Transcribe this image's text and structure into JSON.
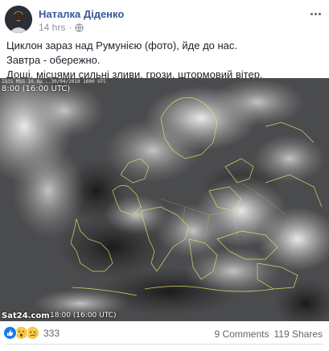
{
  "post": {
    "author": "Наталка Діденко",
    "time": "14 hrs",
    "separator": "·",
    "text_lines": [
      "Циклон зараз над Румунією (фото), йде до нас.",
      "Завтра - обережно.",
      "Дощі, місцями сильні зливи, грози, штормовий вітер."
    ],
    "image": {
      "caption_top": "IQ31 MSG 10.8µ ..30/04/2019 1600 UTC",
      "time_top": "8:00 (16:00 UTC)",
      "source": "Sat24.com",
      "time_bottom": "18:00 (16:00 UTC)"
    },
    "reactions": {
      "icons": [
        "like-icon",
        "wow-icon",
        "sad-icon"
      ],
      "count": "333"
    },
    "comments": "9 Comments",
    "shares": "119 Shares"
  },
  "colors": {
    "author_link": "#385898",
    "meta_gray": "#90949c",
    "like_blue": "#1877f2",
    "emoji_yellow": "#f7c94a"
  }
}
